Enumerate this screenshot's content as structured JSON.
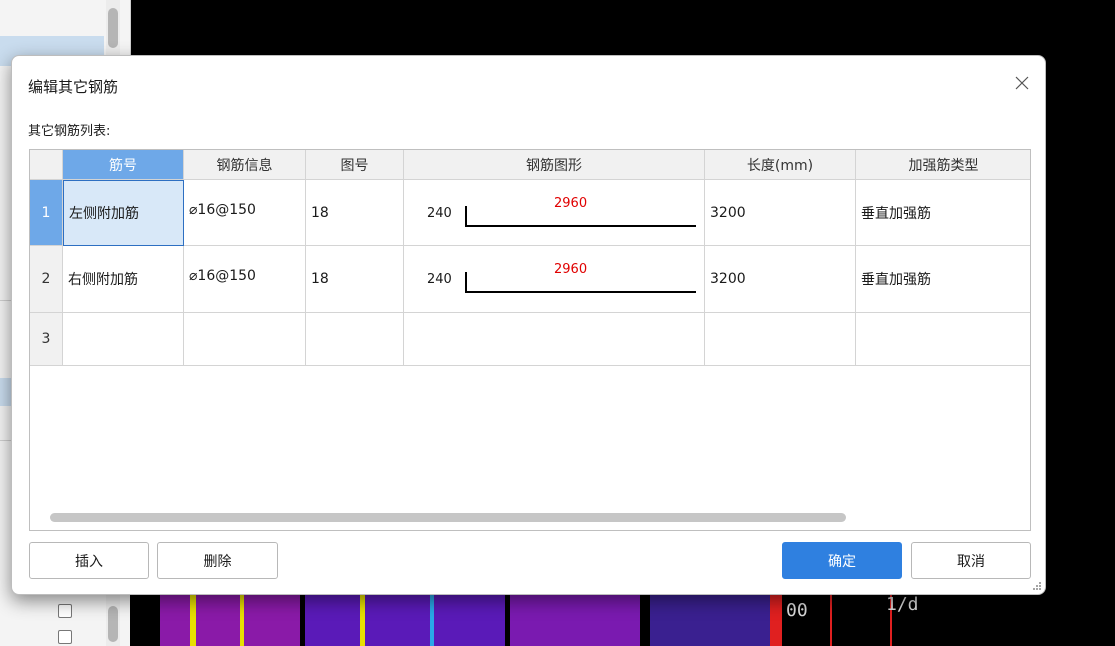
{
  "dialog": {
    "title": "编辑其它钢筋",
    "list_label": "其它钢筋列表:"
  },
  "table": {
    "columns": [
      "筋号",
      "钢筋信息",
      "图号",
      "钢筋图形",
      "长度(mm)",
      "加强筋类型"
    ],
    "rows": [
      {
        "num": "1",
        "name": "左侧附加筋",
        "info": "⌀16@150",
        "fig": "18",
        "shape_left": "240",
        "shape_main": "2960",
        "length": "3200",
        "type": "垂直加强筋"
      },
      {
        "num": "2",
        "name": "右侧附加筋",
        "info": "⌀16@150",
        "fig": "18",
        "shape_left": "240",
        "shape_main": "2960",
        "length": "3200",
        "type": "垂直加强筋"
      },
      {
        "num": "3",
        "name": "",
        "info": "",
        "fig": "",
        "shape_left": "",
        "shape_main": "",
        "length": "",
        "type": ""
      }
    ],
    "selected_row": 1
  },
  "buttons": {
    "insert": "插入",
    "delete": "删除",
    "ok": "确定",
    "cancel": "取消"
  },
  "background": {
    "cad_text_1": "00",
    "cad_text_2": "1/d"
  },
  "colors": {
    "accent": "#2f80e0",
    "header_selected": "#6ea8e8",
    "dimension_red": "#e00000"
  },
  "icons": {
    "close": "close-icon",
    "resize": "resize-grip-icon"
  }
}
